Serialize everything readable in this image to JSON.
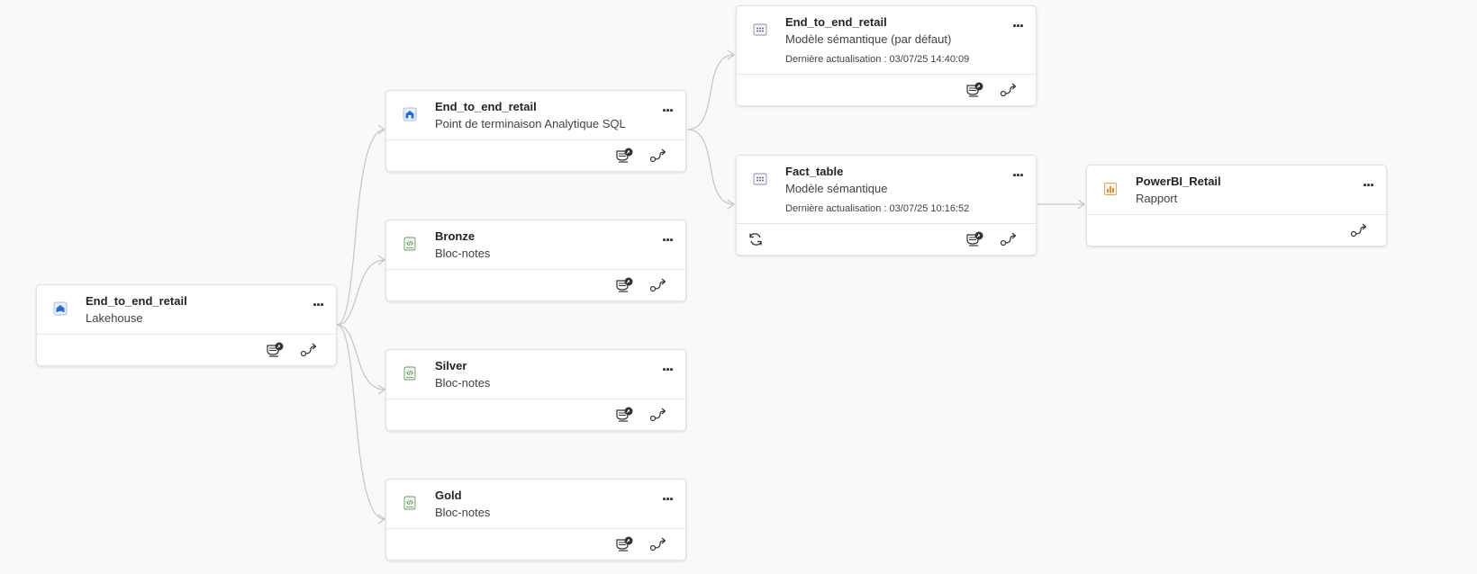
{
  "cards": {
    "lakehouse": {
      "title": "End_to_end_retail",
      "subtitle": "Lakehouse",
      "icon": "lakehouse-icon",
      "actions": [
        "impact-analysis-icon",
        "lineage-icon"
      ]
    },
    "sql_endpoint": {
      "title": "End_to_end_retail",
      "subtitle": "Point de terminaison Analytique SQL",
      "icon": "sql-endpoint-icon",
      "actions": [
        "impact-analysis-icon",
        "lineage-icon"
      ]
    },
    "bronze": {
      "title": "Bronze",
      "subtitle": "Bloc-notes",
      "icon": "notebook-icon",
      "actions": [
        "impact-analysis-icon",
        "lineage-icon"
      ]
    },
    "silver": {
      "title": "Silver",
      "subtitle": "Bloc-notes",
      "icon": "notebook-icon",
      "actions": [
        "impact-analysis-icon",
        "lineage-icon"
      ]
    },
    "gold": {
      "title": "Gold",
      "subtitle": "Bloc-notes",
      "icon": "notebook-icon",
      "actions": [
        "impact-analysis-icon",
        "lineage-icon"
      ]
    },
    "semantic_default": {
      "title": "End_to_end_retail",
      "subtitle": "Modèle sémantique (par défaut)",
      "meta": "Dernière actualisation : 03/07/25 14:40:09",
      "icon": "semantic-model-icon",
      "actions": [
        "impact-analysis-icon",
        "lineage-icon"
      ]
    },
    "fact_table": {
      "title": "Fact_table",
      "subtitle": "Modèle sémantique",
      "meta": "Dernière actualisation : 03/07/25 10:16:52",
      "icon": "semantic-model-icon",
      "actions": [
        "refresh-icon",
        "impact-analysis-icon",
        "lineage-icon"
      ]
    },
    "report": {
      "title": "PowerBI_Retail",
      "subtitle": "Rapport",
      "icon": "report-icon",
      "actions": [
        "lineage-icon"
      ]
    }
  },
  "more_label": "...",
  "colors": {
    "background": "#f9f9f9",
    "connector": "#c8c8c8",
    "icon_blue": "#2b6cd4",
    "icon_green": "#4e8a4a",
    "icon_orange": "#d4892b"
  }
}
